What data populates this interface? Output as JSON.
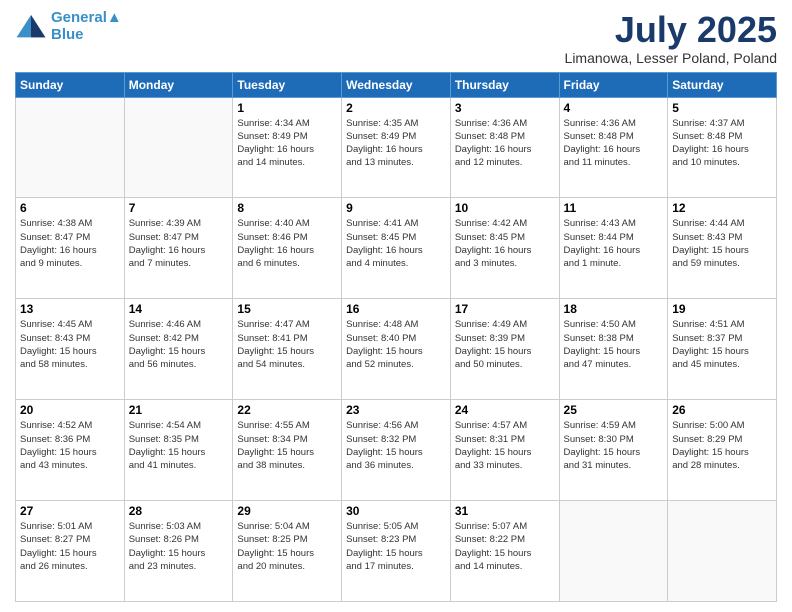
{
  "logo": {
    "line1": "General",
    "line2": "Blue"
  },
  "title": "July 2025",
  "subtitle": "Limanowa, Lesser Poland, Poland",
  "headers": [
    "Sunday",
    "Monday",
    "Tuesday",
    "Wednesday",
    "Thursday",
    "Friday",
    "Saturday"
  ],
  "days": [
    {
      "num": "",
      "info": ""
    },
    {
      "num": "",
      "info": ""
    },
    {
      "num": "1",
      "info": "Sunrise: 4:34 AM\nSunset: 8:49 PM\nDaylight: 16 hours\nand 14 minutes."
    },
    {
      "num": "2",
      "info": "Sunrise: 4:35 AM\nSunset: 8:49 PM\nDaylight: 16 hours\nand 13 minutes."
    },
    {
      "num": "3",
      "info": "Sunrise: 4:36 AM\nSunset: 8:48 PM\nDaylight: 16 hours\nand 12 minutes."
    },
    {
      "num": "4",
      "info": "Sunrise: 4:36 AM\nSunset: 8:48 PM\nDaylight: 16 hours\nand 11 minutes."
    },
    {
      "num": "5",
      "info": "Sunrise: 4:37 AM\nSunset: 8:48 PM\nDaylight: 16 hours\nand 10 minutes."
    },
    {
      "num": "6",
      "info": "Sunrise: 4:38 AM\nSunset: 8:47 PM\nDaylight: 16 hours\nand 9 minutes."
    },
    {
      "num": "7",
      "info": "Sunrise: 4:39 AM\nSunset: 8:47 PM\nDaylight: 16 hours\nand 7 minutes."
    },
    {
      "num": "8",
      "info": "Sunrise: 4:40 AM\nSunset: 8:46 PM\nDaylight: 16 hours\nand 6 minutes."
    },
    {
      "num": "9",
      "info": "Sunrise: 4:41 AM\nSunset: 8:45 PM\nDaylight: 16 hours\nand 4 minutes."
    },
    {
      "num": "10",
      "info": "Sunrise: 4:42 AM\nSunset: 8:45 PM\nDaylight: 16 hours\nand 3 minutes."
    },
    {
      "num": "11",
      "info": "Sunrise: 4:43 AM\nSunset: 8:44 PM\nDaylight: 16 hours\nand 1 minute."
    },
    {
      "num": "12",
      "info": "Sunrise: 4:44 AM\nSunset: 8:43 PM\nDaylight: 15 hours\nand 59 minutes."
    },
    {
      "num": "13",
      "info": "Sunrise: 4:45 AM\nSunset: 8:43 PM\nDaylight: 15 hours\nand 58 minutes."
    },
    {
      "num": "14",
      "info": "Sunrise: 4:46 AM\nSunset: 8:42 PM\nDaylight: 15 hours\nand 56 minutes."
    },
    {
      "num": "15",
      "info": "Sunrise: 4:47 AM\nSunset: 8:41 PM\nDaylight: 15 hours\nand 54 minutes."
    },
    {
      "num": "16",
      "info": "Sunrise: 4:48 AM\nSunset: 8:40 PM\nDaylight: 15 hours\nand 52 minutes."
    },
    {
      "num": "17",
      "info": "Sunrise: 4:49 AM\nSunset: 8:39 PM\nDaylight: 15 hours\nand 50 minutes."
    },
    {
      "num": "18",
      "info": "Sunrise: 4:50 AM\nSunset: 8:38 PM\nDaylight: 15 hours\nand 47 minutes."
    },
    {
      "num": "19",
      "info": "Sunrise: 4:51 AM\nSunset: 8:37 PM\nDaylight: 15 hours\nand 45 minutes."
    },
    {
      "num": "20",
      "info": "Sunrise: 4:52 AM\nSunset: 8:36 PM\nDaylight: 15 hours\nand 43 minutes."
    },
    {
      "num": "21",
      "info": "Sunrise: 4:54 AM\nSunset: 8:35 PM\nDaylight: 15 hours\nand 41 minutes."
    },
    {
      "num": "22",
      "info": "Sunrise: 4:55 AM\nSunset: 8:34 PM\nDaylight: 15 hours\nand 38 minutes."
    },
    {
      "num": "23",
      "info": "Sunrise: 4:56 AM\nSunset: 8:32 PM\nDaylight: 15 hours\nand 36 minutes."
    },
    {
      "num": "24",
      "info": "Sunrise: 4:57 AM\nSunset: 8:31 PM\nDaylight: 15 hours\nand 33 minutes."
    },
    {
      "num": "25",
      "info": "Sunrise: 4:59 AM\nSunset: 8:30 PM\nDaylight: 15 hours\nand 31 minutes."
    },
    {
      "num": "26",
      "info": "Sunrise: 5:00 AM\nSunset: 8:29 PM\nDaylight: 15 hours\nand 28 minutes."
    },
    {
      "num": "27",
      "info": "Sunrise: 5:01 AM\nSunset: 8:27 PM\nDaylight: 15 hours\nand 26 minutes."
    },
    {
      "num": "28",
      "info": "Sunrise: 5:03 AM\nSunset: 8:26 PM\nDaylight: 15 hours\nand 23 minutes."
    },
    {
      "num": "29",
      "info": "Sunrise: 5:04 AM\nSunset: 8:25 PM\nDaylight: 15 hours\nand 20 minutes."
    },
    {
      "num": "30",
      "info": "Sunrise: 5:05 AM\nSunset: 8:23 PM\nDaylight: 15 hours\nand 17 minutes."
    },
    {
      "num": "31",
      "info": "Sunrise: 5:07 AM\nSunset: 8:22 PM\nDaylight: 15 hours\nand 14 minutes."
    },
    {
      "num": "",
      "info": ""
    },
    {
      "num": "",
      "info": ""
    }
  ]
}
